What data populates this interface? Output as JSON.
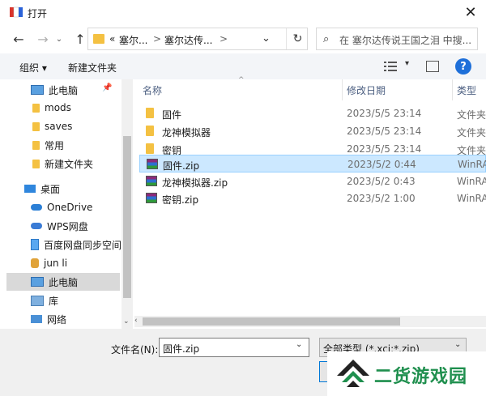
{
  "window": {
    "title": "打开"
  },
  "address": {
    "segment1_prefix": "«",
    "segment1": "塞尔...",
    "segment2": "塞尔达传...",
    "sep": ">"
  },
  "search": {
    "placeholder": "在 塞尔达传说王国之泪 中搜..."
  },
  "toolbar": {
    "organize_label": "组织 ▾",
    "newfolder_label": "新建文件夹"
  },
  "nav": {
    "items": [
      {
        "label": "此电脑",
        "icon": "computer-icon"
      },
      {
        "label": "mods",
        "icon": "folder-icon"
      },
      {
        "label": "saves",
        "icon": "folder-icon"
      },
      {
        "label": "常用",
        "icon": "folder-icon"
      },
      {
        "label": "新建文件夹",
        "icon": "folder-icon"
      },
      {
        "label": "桌面",
        "icon": "desktop-icon"
      },
      {
        "label": "OneDrive",
        "icon": "onedrive-icon"
      },
      {
        "label": "WPS网盘",
        "icon": "wps-cloud-icon"
      },
      {
        "label": "百度网盘同步空间",
        "icon": "baidu-disk-icon"
      },
      {
        "label": "jun li",
        "icon": "user-icon"
      },
      {
        "label": "此电脑",
        "icon": "computer-icon",
        "selected": true
      },
      {
        "label": "库",
        "icon": "library-icon"
      },
      {
        "label": "网络",
        "icon": "network-icon"
      }
    ]
  },
  "columns": {
    "name": "名称",
    "date": "修改日期",
    "type": "类型"
  },
  "files": [
    {
      "name": "固件",
      "date": "2023/5/5 23:14",
      "type": "文件夹",
      "kind": "folder"
    },
    {
      "name": "龙神模拟器",
      "date": "2023/5/5 23:14",
      "type": "文件夹",
      "kind": "folder"
    },
    {
      "name": "密钥",
      "date": "2023/5/5 23:14",
      "type": "文件夹",
      "kind": "folder"
    },
    {
      "name": "固件.zip",
      "date": "2023/5/2 0:44",
      "type": "WinRAR",
      "kind": "zip",
      "selected": true
    },
    {
      "name": "龙神模拟器.zip",
      "date": "2023/5/2 0:43",
      "type": "WinRAR",
      "kind": "zip"
    },
    {
      "name": "密钥.zip",
      "date": "2023/5/2 1:00",
      "type": "WinRAR",
      "kind": "zip"
    }
  ],
  "bottom": {
    "filename_label": "文件名(N):",
    "filename_value": "固件.zip",
    "filetype_value": "全部类型 (*.xci;*.zip)"
  },
  "watermark": {
    "text": "二货游戏园"
  }
}
